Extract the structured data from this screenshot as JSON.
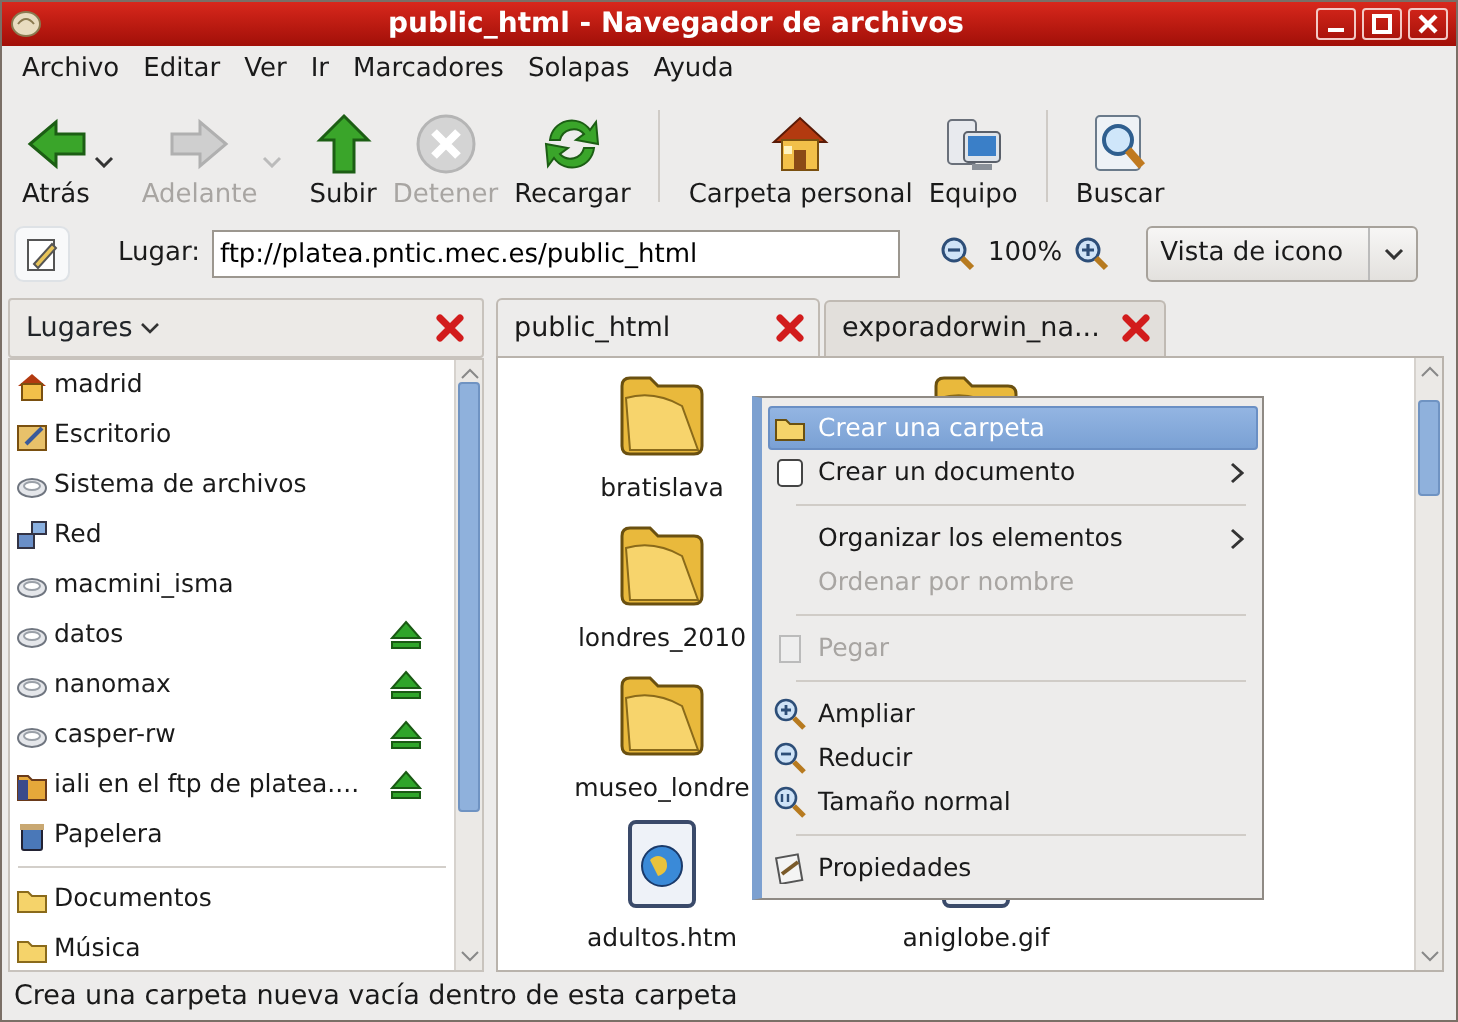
{
  "window": {
    "title": "public_html - Navegador de archivos"
  },
  "menu_bar": [
    "Archivo",
    "Editar",
    "Ver",
    "Ir",
    "Marcadores",
    "Solapas",
    "Ayuda"
  ],
  "toolbar": [
    [
      {
        "label": "Atrás",
        "disabled": false,
        "dropdown": true
      },
      {
        "label": "Adelante",
        "disabled": true,
        "dropdown": true
      },
      {
        "label": "Subir",
        "disabled": false,
        "dropdown": false
      },
      {
        "label": "Detener",
        "disabled": true,
        "dropdown": false
      },
      {
        "label": "Recargar",
        "disabled": false,
        "dropdown": false
      }
    ],
    [
      {
        "label": "Carpeta personal",
        "disabled": false,
        "dropdown": false
      },
      {
        "label": "Equipo",
        "disabled": false,
        "dropdown": false
      }
    ],
    [
      {
        "label": "Buscar",
        "disabled": false,
        "dropdown": false
      }
    ]
  ],
  "location": {
    "label": "Lugar:",
    "value": "ftp://platea.pntic.mec.es/public_html",
    "zoom": "100%",
    "view": "Vista de icono"
  },
  "sidebar": {
    "title": "Lugares",
    "sections": [
      [
        {
          "label": "madrid",
          "ejectable": false
        },
        {
          "label": "Escritorio",
          "ejectable": false
        },
        {
          "label": "Sistema de archivos",
          "ejectable": false
        },
        {
          "label": "Red",
          "ejectable": false
        },
        {
          "label": "macmini_isma",
          "ejectable": false
        },
        {
          "label": "datos",
          "ejectable": true
        },
        {
          "label": "nanomax",
          "ejectable": true
        },
        {
          "label": "casper-rw",
          "ejectable": true
        },
        {
          "label": "iali en el ftp de platea....",
          "ejectable": true
        },
        {
          "label": "Papelera",
          "ejectable": false
        }
      ],
      [
        {
          "label": "Documentos",
          "ejectable": false
        },
        {
          "label": "Música",
          "ejectable": false
        }
      ]
    ]
  },
  "tabs": [
    {
      "label": "public_html",
      "selected": true
    },
    {
      "label": "exporadorwin_na...",
      "selected": false
    }
  ],
  "icon_rows": [
    [
      {
        "kind": "folder",
        "name": "bratislava"
      },
      {
        "kind": "folder"
      }
    ],
    [
      {
        "kind": "folder",
        "name": "londres_2010"
      }
    ],
    [
      {
        "kind": "folder",
        "name": "museo_londre"
      }
    ],
    [
      {
        "kind": "web",
        "name": "adultos.htm"
      },
      {
        "kind": "image",
        "name": "aniglobe.gif"
      }
    ]
  ],
  "context_menu": {
    "sections": [
      [
        {
          "label": "Crear una carpeta",
          "selected": true,
          "disabled": false,
          "submenu": false
        },
        {
          "label": "Crear un documento",
          "selected": false,
          "disabled": false,
          "submenu": true
        }
      ],
      [
        {
          "label": "Organizar los elementos",
          "selected": false,
          "disabled": false,
          "submenu": true
        },
        {
          "label": "Ordenar por nombre",
          "selected": false,
          "disabled": true,
          "submenu": false
        }
      ],
      [
        {
          "label": "Pegar",
          "selected": false,
          "disabled": true,
          "submenu": false
        }
      ],
      [
        {
          "label": "Ampliar",
          "selected": false,
          "disabled": false,
          "submenu": false
        },
        {
          "label": "Reducir",
          "selected": false,
          "disabled": false,
          "submenu": false
        },
        {
          "label": "Tamaño normal",
          "selected": false,
          "disabled": false,
          "submenu": false
        }
      ],
      [
        {
          "label": "Propiedades",
          "selected": false,
          "disabled": false,
          "submenu": false
        }
      ]
    ]
  },
  "status_bar": "Crea una carpeta nueva vacía dentro de esta carpeta"
}
